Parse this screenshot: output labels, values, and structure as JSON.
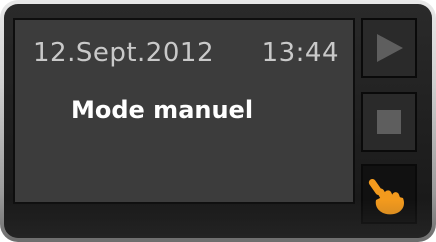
{
  "screen": {
    "date": "12.Sept.2012",
    "time": "13:44",
    "mode": "Mode manuel"
  },
  "buttons": {
    "play": {
      "icon": "play-icon"
    },
    "stop": {
      "icon": "stop-icon"
    },
    "manual": {
      "icon": "hand-icon"
    }
  },
  "colors": {
    "screen_bg": "#3c3c3c",
    "text_secondary": "#c9c9c9",
    "text_primary": "#ffffff",
    "icon_gray": "#5e5e5e",
    "hand_orange": "#f39a1d"
  }
}
